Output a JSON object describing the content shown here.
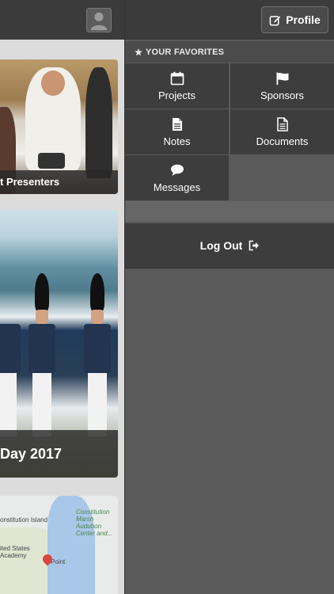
{
  "feed": {
    "card1_caption": "t Presenters",
    "card2_caption": "Day 2017",
    "map_labels": {
      "island": "onstitution Island",
      "marsh": "Constitution Marsh Audubon Center and...",
      "academy": "ited States Academy",
      "point": "Point"
    }
  },
  "drawer": {
    "profile_label": "Profile",
    "favorites_header": "YOUR FAVORITES",
    "favorites": [
      {
        "label": "Projects",
        "icon": "calendar-icon"
      },
      {
        "label": "Sponsors",
        "icon": "flag-icon"
      },
      {
        "label": "Notes",
        "icon": "note-icon"
      },
      {
        "label": "Documents",
        "icon": "document-icon"
      },
      {
        "label": "Messages",
        "icon": "chat-bubble-icon"
      }
    ],
    "logout_label": "Log Out"
  }
}
